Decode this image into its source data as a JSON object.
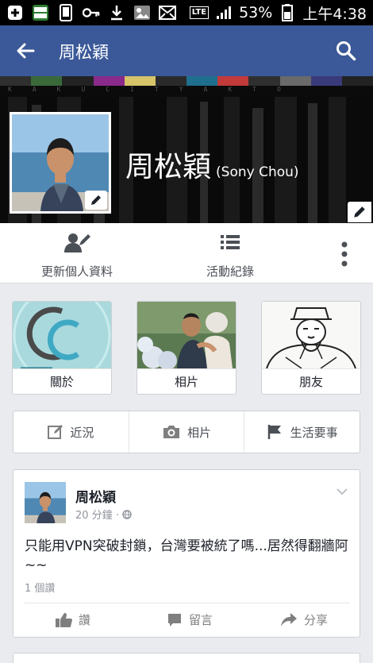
{
  "status_bar": {
    "battery": "53%",
    "time": "上午4:38",
    "network": "LTE"
  },
  "app_bar": {
    "title": "周松穎"
  },
  "profile": {
    "name": "周松穎",
    "alt_name": "(Sony Chou)"
  },
  "actions": {
    "update_info": "更新個人資料",
    "activity_log": "活動紀錄"
  },
  "tiles": [
    {
      "label": "關於"
    },
    {
      "label": "相片"
    },
    {
      "label": "朋友"
    }
  ],
  "composer": {
    "status": "近況",
    "photo": "相片",
    "life_event": "生活要事"
  },
  "post": {
    "author": "周松穎",
    "time": "20 分鐘",
    "text": "只能用VPN突破封鎖，台灣要被統了嗎...居然得翻牆阿~~",
    "likes": "1 個讚",
    "like_label": "讚",
    "comment_label": "留言",
    "share_label": "分享"
  },
  "colors": {
    "brand": "#3b5998",
    "background": "#e9ebee"
  },
  "icons": [
    "back-arrow-icon",
    "search-icon",
    "pencil-icon",
    "user-edit-icon",
    "list-icon",
    "more-vertical-icon",
    "edit-square-icon",
    "camera-icon",
    "flag-icon",
    "thumbs-up-icon",
    "comment-icon",
    "share-icon",
    "chevron-down-icon",
    "globe-icon"
  ]
}
